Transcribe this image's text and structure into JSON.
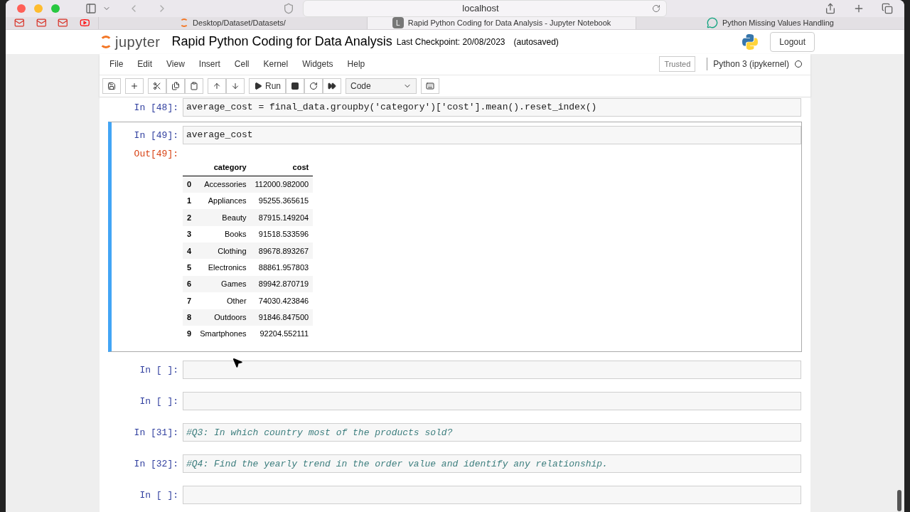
{
  "browser": {
    "address": "localhost",
    "bookmarks": [
      {
        "kind": "mail"
      },
      {
        "kind": "mail"
      },
      {
        "kind": "mail"
      },
      {
        "kind": "video"
      }
    ],
    "tabs": [
      {
        "label": "Desktop/Dataset/Datasets/",
        "kind": "jupyter",
        "selected": false
      },
      {
        "label": "Rapid Python Coding for Data Analysis - Jupyter Notebook",
        "kind": "letter",
        "icon_text": "L",
        "selected": true
      },
      {
        "label": "Python Missing Values Handling",
        "kind": "chat",
        "selected": false
      }
    ]
  },
  "header": {
    "logo_text": "jupyter",
    "title": "Rapid Python Coding for Data Analysis",
    "checkpoint": "Last Checkpoint: 20/08/2023",
    "autosave": "(autosaved)",
    "logout": "Logout"
  },
  "menu": [
    "File",
    "Edit",
    "View",
    "Insert",
    "Cell",
    "Kernel",
    "Widgets",
    "Help"
  ],
  "trusted": "Trusted",
  "kernel": "Python 3 (ipykernel)",
  "toolbar": {
    "run": "Run",
    "cell_type": "Code"
  },
  "cells": [
    {
      "kind": "partial",
      "prompt": "In [48]:",
      "code": "average_cost = final_data.groupby('category')['cost'].mean().reset_index()",
      "selected": false
    },
    {
      "kind": "output",
      "prompt": "In [49]:",
      "code": "average_cost",
      "selected": true,
      "out_prompt": "Out[49]:",
      "columns": [
        "",
        "category",
        "cost"
      ],
      "rows": [
        [
          "0",
          "Accessories",
          "112000.982000"
        ],
        [
          "1",
          "Appliances",
          "95255.365615"
        ],
        [
          "2",
          "Beauty",
          "87915.149204"
        ],
        [
          "3",
          "Books",
          "91518.533596"
        ],
        [
          "4",
          "Clothing",
          "89678.893267"
        ],
        [
          "5",
          "Electronics",
          "88861.957803"
        ],
        [
          "6",
          "Games",
          "89942.870719"
        ],
        [
          "7",
          "Other",
          "74030.423846"
        ],
        [
          "8",
          "Outdoors",
          "91846.847500"
        ],
        [
          "9",
          "Smartphones",
          "92204.552111"
        ]
      ]
    },
    {
      "kind": "code",
      "prompt": "In [ ]:",
      "selected": false
    },
    {
      "kind": "code",
      "prompt": "In [ ]:",
      "selected": false
    },
    {
      "kind": "comment",
      "prompt": "In [31]:",
      "code": "#Q3: In which country most of the products sold?",
      "selected": false
    },
    {
      "kind": "comment",
      "prompt": "In [32]:",
      "code": "#Q4: Find the yearly trend in the order value and identify any relationship.",
      "selected": false
    },
    {
      "kind": "code",
      "prompt": "In [ ]:",
      "selected": false
    }
  ]
}
